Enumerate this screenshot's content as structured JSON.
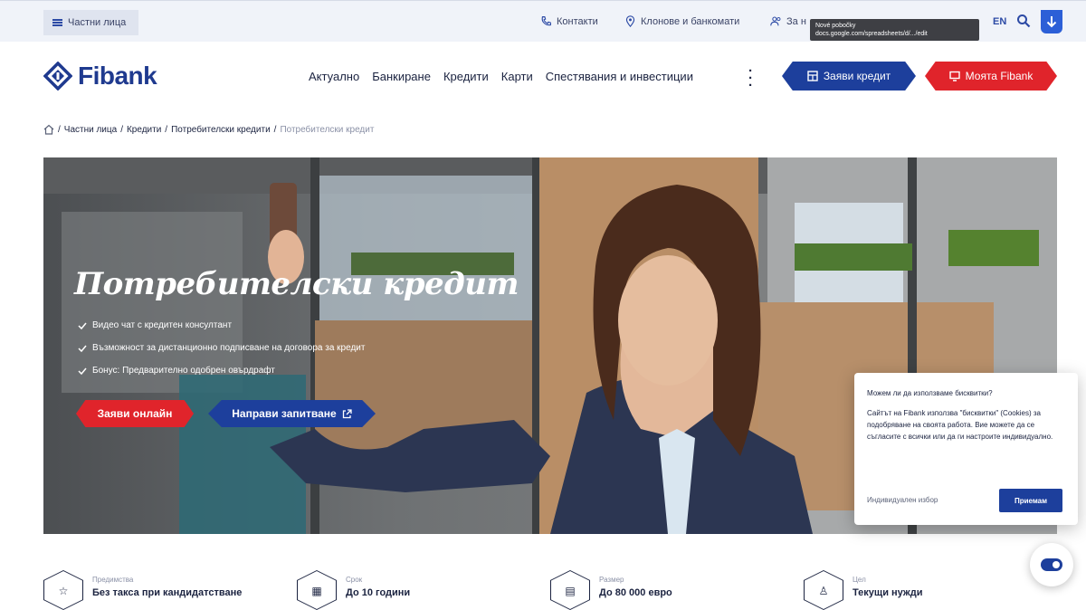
{
  "topbar": {
    "segment_label": "Частни лица",
    "contacts_label": "Контакти",
    "branches_label": "Клонове и банкомати",
    "about_label": "За н",
    "tooltip_line1": "Nové pobočky",
    "tooltip_line2": "docs.google.com/spreadsheets/d/.../edit",
    "lang_label": "EN"
  },
  "header": {
    "logo_text": "Fibank",
    "nav": [
      "Актуално",
      "Банкиране",
      "Кредити",
      "Карти",
      "Спестявания и инвестиции"
    ],
    "apply_credit_label": "Заяви кредит",
    "my_fibank_label": "Моята Fibank"
  },
  "breadcrumb": {
    "items": [
      "Частни лица",
      "Кредити",
      "Потребителски кредити"
    ],
    "current": "Потребителски кредит"
  },
  "hero": {
    "title": "Потребителски кредит",
    "bullets": [
      "Видео чат с кредитен консултант",
      "Възможност за дистанционно подписване на договора за кредит",
      "Бонус: Предварително одобрен овърдрафт"
    ],
    "apply_online_label": "Заяви онлайн",
    "inquiry_label": "Направи запитване"
  },
  "cookie": {
    "heading": "Можем ли да използваме бисквитки?",
    "body": "Сайтът на Fibank използва \"бисквитки\" (Cookies) за подобряване на своята работа. Вие можете да се съгласите с всички или да ги настроите индивидуално.",
    "individual_label": "Индивидуален избор",
    "accept_label": "Приемам"
  },
  "features": [
    {
      "label": "Предимства",
      "value": "Без такса при кандидатстване",
      "icon": "star-icon"
    },
    {
      "label": "Срок",
      "value": "До 10 години",
      "icon": "calendar-icon"
    },
    {
      "label": "Размер",
      "value": "До 80 000 евро",
      "icon": "wallet-icon"
    },
    {
      "label": "Цел",
      "value": "Текущи нужди",
      "icon": "person-icon"
    }
  ],
  "colors": {
    "brand_blue": "#1d3f9c",
    "brand_red": "#e0242b",
    "link_blue": "#2c5fd7"
  }
}
